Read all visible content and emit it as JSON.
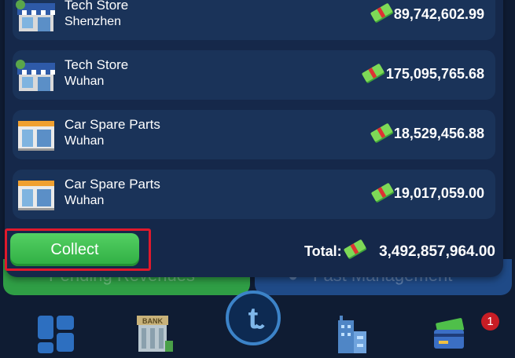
{
  "background_tabs": {
    "left_label": "Pending Revenues",
    "right_label": "Fast Management"
  },
  "stores": [
    {
      "name": "Tech Store",
      "city": "Shenzhen",
      "amount": "89,742,602.99",
      "icon": "tech-store-icon"
    },
    {
      "name": "Tech Store",
      "city": "Wuhan",
      "amount": "175,095,765.68",
      "icon": "tech-store-icon"
    },
    {
      "name": "Car Spare Parts",
      "city": "Wuhan",
      "amount": "18,529,456.88",
      "icon": "car-spare-parts-store-icon"
    },
    {
      "name": "Car Spare Parts",
      "city": "Wuhan",
      "amount": "19,017,059.00",
      "icon": "car-spare-parts-store-icon"
    }
  ],
  "footer": {
    "collect_label": "Collect",
    "total_label": "Total:",
    "total_value": "3,492,857,964.00"
  },
  "bottom_nav": {
    "bank_label": "BANK",
    "notification_count": "1"
  },
  "colors": {
    "panel": "#15284a",
    "card": "#1a3359",
    "collect_green": "#3cbd4e",
    "highlight_red": "#e0192c",
    "badge_red": "#c81d25"
  }
}
